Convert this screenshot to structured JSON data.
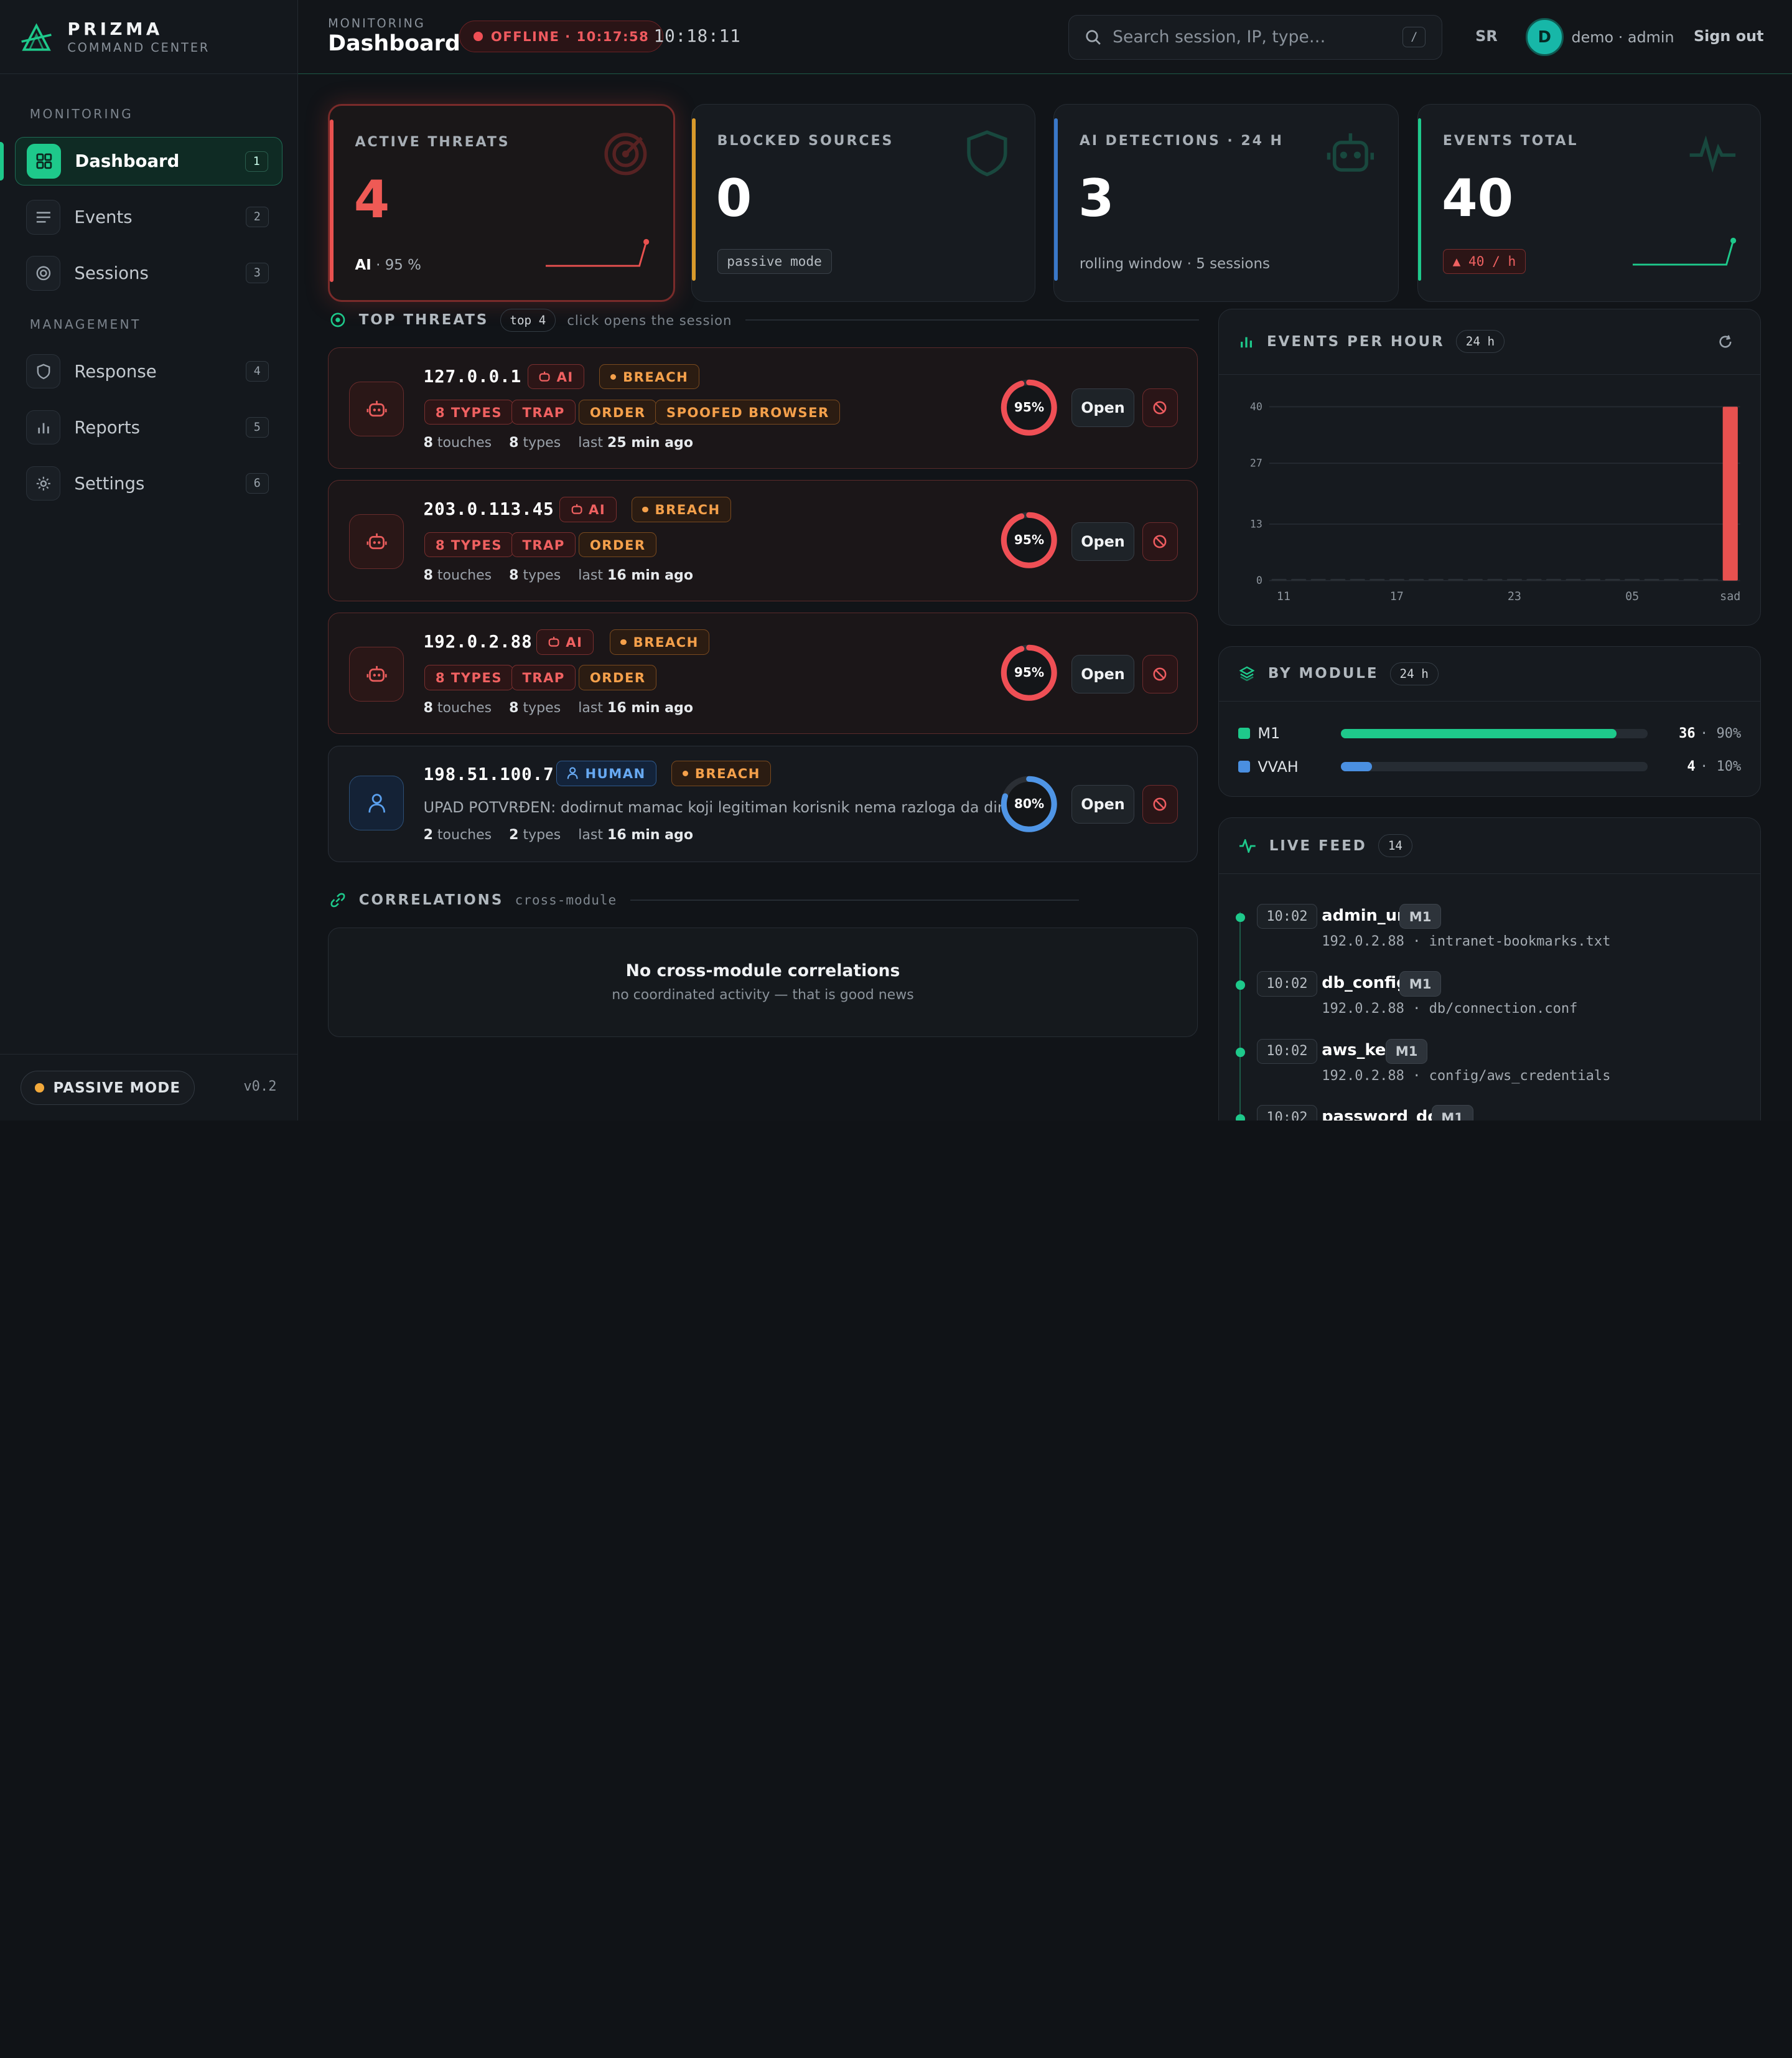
{
  "brand": {
    "name": "PRIZMA",
    "subtitle": "COMMAND CENTER"
  },
  "sidebar": {
    "sections": [
      "MONITORING",
      "MANAGEMENT"
    ],
    "items": [
      {
        "label": "Dashboard",
        "badge": "1",
        "icon": "grid-icon"
      },
      {
        "label": "Events",
        "badge": "2",
        "icon": "list-icon"
      },
      {
        "label": "Sessions",
        "badge": "3",
        "icon": "target-icon"
      },
      {
        "label": "Response",
        "badge": "4",
        "icon": "shield-icon"
      },
      {
        "label": "Reports",
        "badge": "5",
        "icon": "bar-chart-icon"
      },
      {
        "label": "Settings",
        "badge": "6",
        "icon": "gear-icon"
      }
    ],
    "mode": "PASSIVE MODE",
    "version": "v0.2"
  },
  "header": {
    "crumb": "MONITORING",
    "title": "Dashboard",
    "status": "OFFLINE · 10:17:58",
    "clock": "10:18:11",
    "search_placeholder": "Search session, IP, type…",
    "search_key": "/",
    "lang": "SR",
    "avatar": "D",
    "user": "demo · admin",
    "signout": "Sign out"
  },
  "kpis": [
    {
      "label": "ACTIVE THREATS",
      "value": "4",
      "sub": "AI",
      "sub2": " · 95 %",
      "accent": "#e8514f"
    },
    {
      "label": "BLOCKED SOURCES",
      "value": "0",
      "chip": "passive mode",
      "accent": "#d99a2b"
    },
    {
      "label": "AI DETECTIONS · 24 H",
      "value": "3",
      "sub": "rolling window · 5 sessions",
      "accent": "#3a78c9"
    },
    {
      "label": "EVENTS TOTAL",
      "value": "40",
      "chip": "▲ 40 / h",
      "accent": "#1ec98b"
    }
  ],
  "threats_section": {
    "title": "TOP THREATS",
    "pill": "top 4",
    "note": "click opens the session"
  },
  "threats": [
    {
      "ip": "127.0.0.1",
      "kind": "AI",
      "flag": "BREACH",
      "tags": [
        "8 TYPES",
        "TRAP",
        "ORDER",
        "SPOOFED BROWSER"
      ],
      "touches": "8",
      "types": "8",
      "last": "25 min ago",
      "score": "95%",
      "score_value": 95,
      "open": "Open"
    },
    {
      "ip": "203.0.113.45",
      "kind": "AI",
      "flag": "BREACH",
      "tags": [
        "8 TYPES",
        "TRAP",
        "ORDER"
      ],
      "touches": "8",
      "types": "8",
      "last": "16 min ago",
      "score": "95%",
      "score_value": 95,
      "open": "Open"
    },
    {
      "ip": "192.0.2.88",
      "kind": "AI",
      "flag": "BREACH",
      "tags": [
        "8 TYPES",
        "TRAP",
        "ORDER"
      ],
      "touches": "8",
      "types": "8",
      "last": "16 min ago",
      "score": "95%",
      "score_value": 95,
      "open": "Open"
    },
    {
      "ip": "198.51.100.7",
      "kind": "HUMAN",
      "flag": "BREACH",
      "desc": "UPAD POTVRĐEN: dodirnut mamac koji legitiman korisnik nema razloga da dira",
      "touches": "2",
      "types": "2",
      "last": "16 min ago",
      "score": "80%",
      "score_value": 80,
      "open": "Open"
    }
  ],
  "meta_words": {
    "touches": "touches",
    "types": "types",
    "last": "last"
  },
  "correlations": {
    "title": "CORRELATIONS",
    "note": "cross-module",
    "empty_title": "No cross-module correlations",
    "empty_sub": "no coordinated activity — that is good news"
  },
  "events_panel": {
    "title": "EVENTS PER HOUR",
    "pill": "24 h"
  },
  "chart_data": {
    "type": "bar",
    "categories": [
      "11",
      "17",
      "23",
      "05",
      "sad"
    ],
    "yticks": [
      "0",
      "13",
      "27",
      "40"
    ],
    "ylim": [
      0,
      40
    ],
    "values": [
      0,
      0,
      0,
      0,
      40
    ],
    "bar_color": "#e8514f"
  },
  "module_panel": {
    "title": "BY MODULE",
    "pill": "24 h",
    "modules": [
      {
        "name": "M1",
        "count": "36",
        "pct": "90%",
        "fraction": 0.9,
        "color": "#1ec98b"
      },
      {
        "name": "VVAH",
        "count": "4",
        "pct": "10%",
        "fraction": 0.1,
        "color": "#4a8fe0"
      }
    ]
  },
  "feed_panel": {
    "title": "LIVE FEED",
    "pill": "14",
    "items": [
      {
        "time": "10:02",
        "name": "admin_url",
        "module": "M1",
        "ip": "192.0.2.88",
        "path": "intranet-bookmarks.txt"
      },
      {
        "time": "10:02",
        "name": "db_config",
        "module": "M1",
        "ip": "192.0.2.88",
        "path": "db/connection.conf"
      },
      {
        "time": "10:02",
        "name": "aws_key",
        "module": "M1",
        "ip": "192.0.2.88",
        "path": "config/aws_credentials"
      },
      {
        "time": "10:02",
        "name": "password_doc",
        "module": "M1",
        "ip": "",
        "path": ""
      }
    ]
  }
}
